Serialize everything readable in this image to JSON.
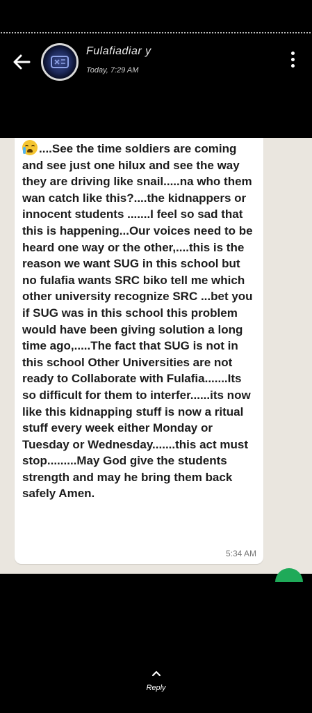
{
  "header": {
    "title": "Fulafiadiar y",
    "subtitle": "Today, 7:29 AM",
    "back_icon": "arrow-left-icon",
    "menu_icon": "more-vertical-icon"
  },
  "message": {
    "emoji": "crying-face-emoji",
    "text": "....See the time soldiers are coming and see just one hilux and see the way they are driving like snail.....na who them wan catch like this?....the kidnappers or innocent students .......I feel so sad that this is happening...Our voices need to be heard one way or the other,....this is the reason we want SUG in this school but no fulafia wants SRC biko tell me which other university recognize SRC ...bet you if SUG was in this school this problem would have been giving solution a long time ago,.....The fact that SUG is not in this school Other Universities are not ready to Collaborate with Fulafia.......Its so difficult for them to interfer......its now like this kidnapping stuff is now a ritual stuff every week either Monday or Tuesday or Wednesday.......this act must stop.........May God give the students strength and may he bring them back safely Amen.",
    "time": "5:34 AM"
  },
  "footer": {
    "reply_label": "Reply",
    "reply_icon": "chevron-up-icon"
  }
}
